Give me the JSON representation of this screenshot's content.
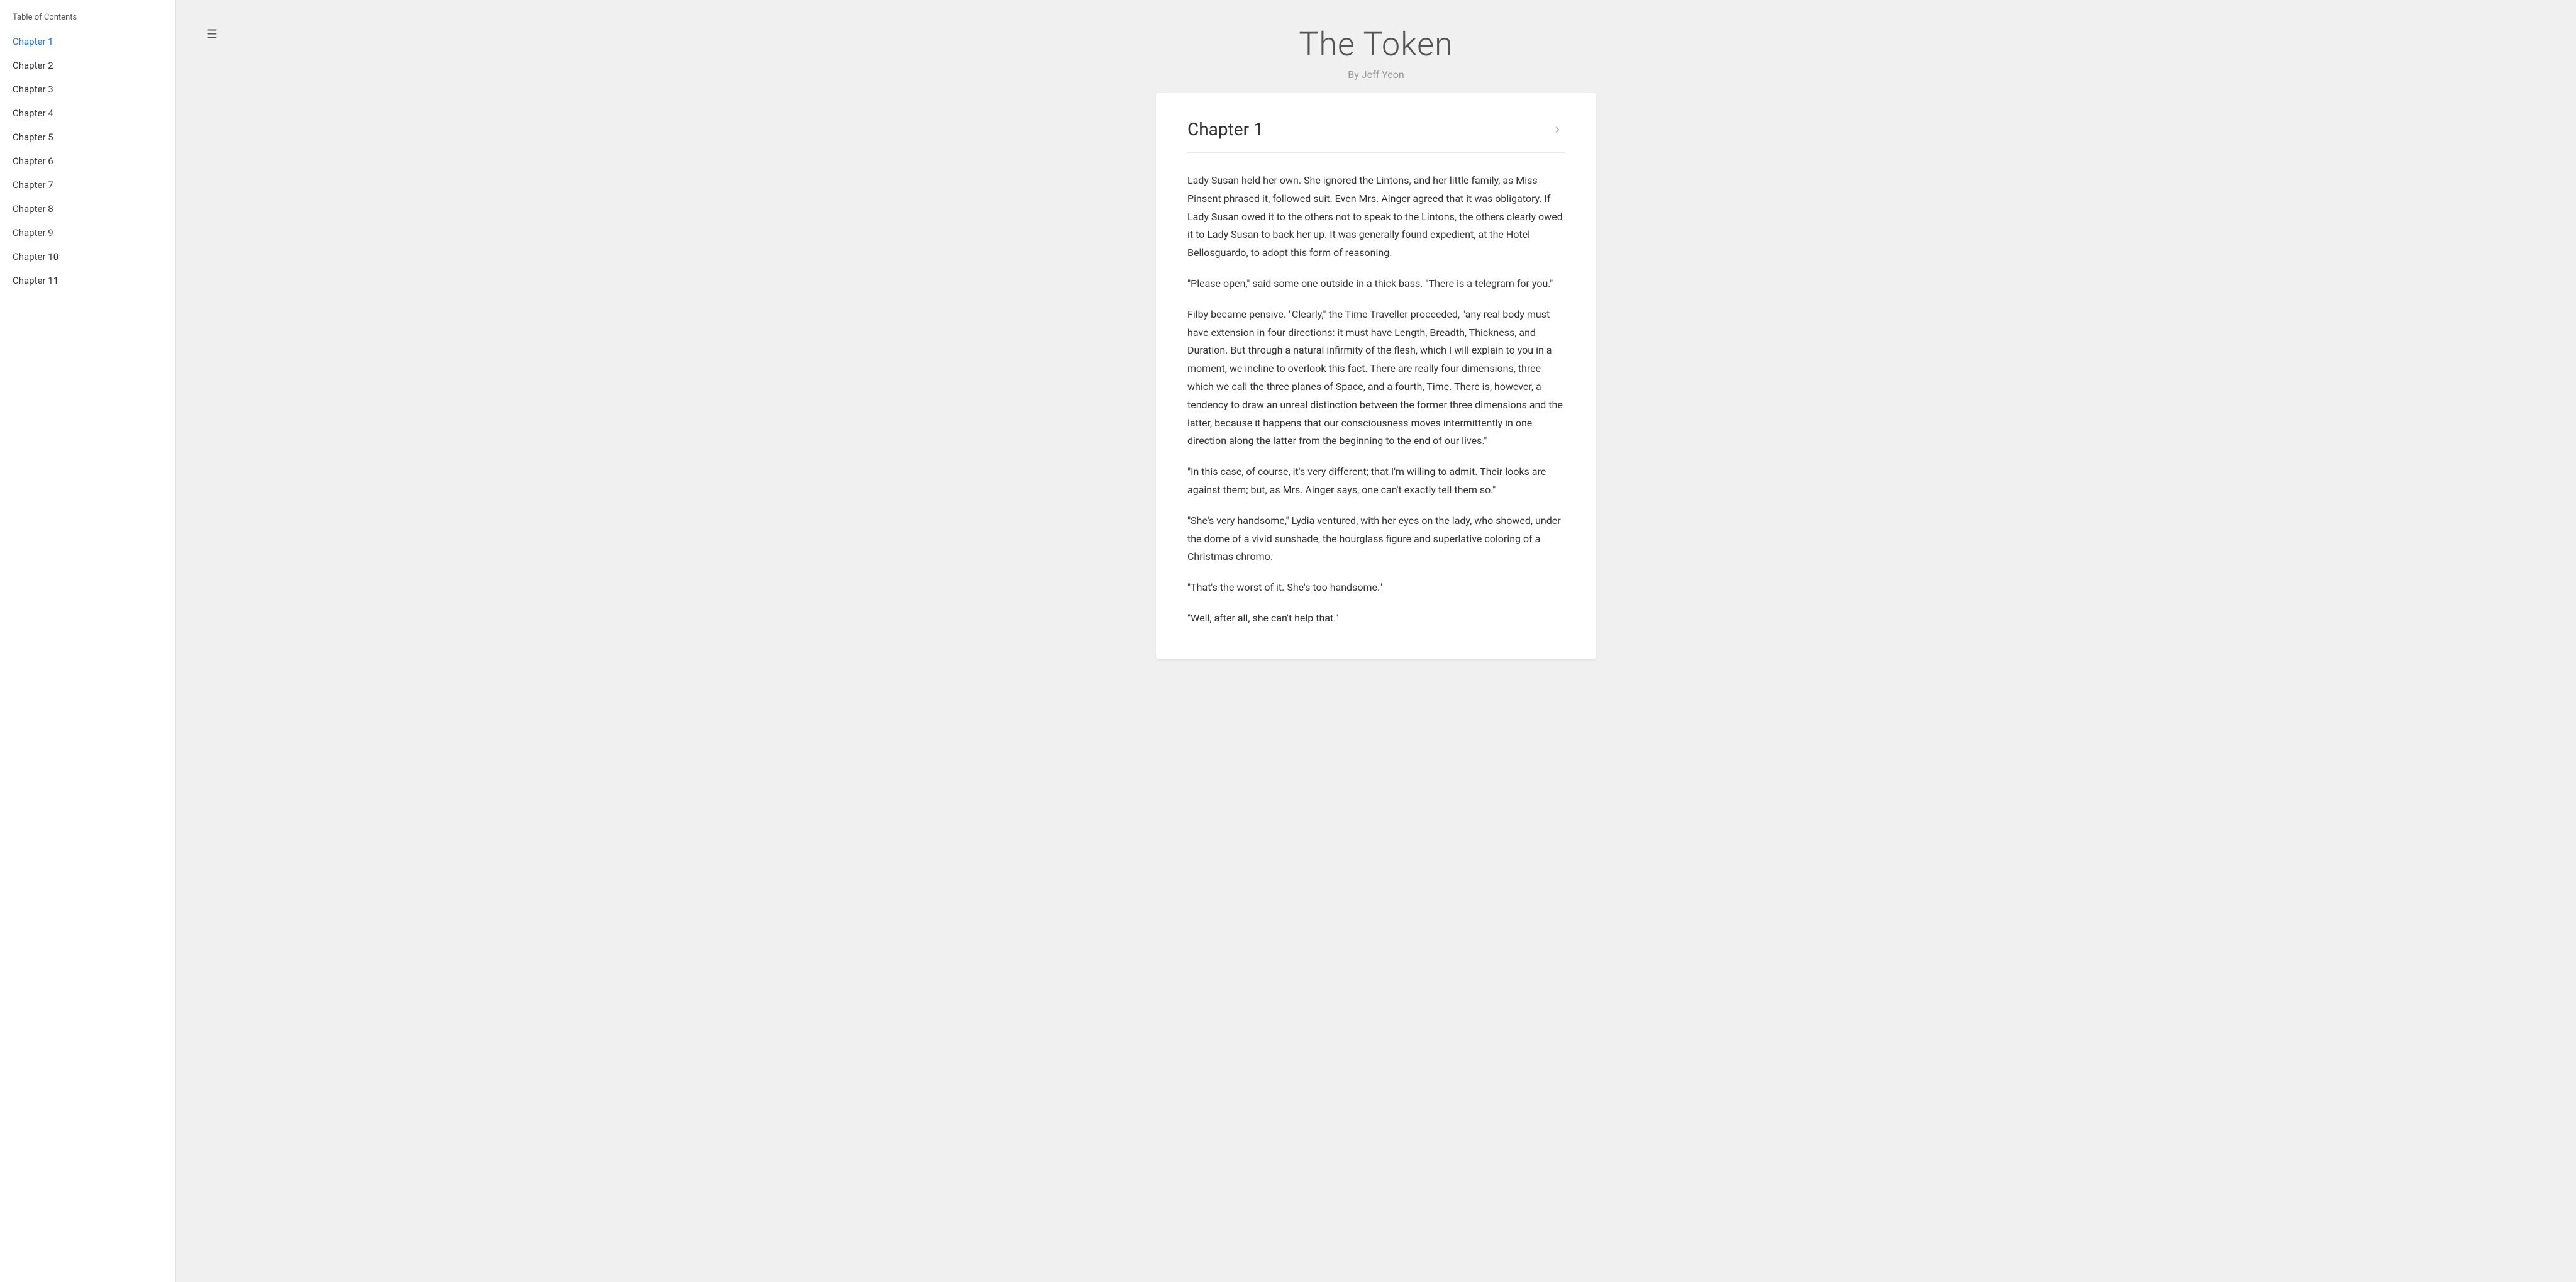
{
  "sidebar": {
    "toc_label": "Table of Contents",
    "chapters": [
      {
        "label": "Chapter 1",
        "active": true
      },
      {
        "label": "Chapter 2",
        "active": false
      },
      {
        "label": "Chapter 3",
        "active": false
      },
      {
        "label": "Chapter 4",
        "active": false
      },
      {
        "label": "Chapter 5",
        "active": false
      },
      {
        "label": "Chapter 6",
        "active": false
      },
      {
        "label": "Chapter 7",
        "active": false
      },
      {
        "label": "Chapter 8",
        "active": false
      },
      {
        "label": "Chapter 9",
        "active": false
      },
      {
        "label": "Chapter 10",
        "active": false
      },
      {
        "label": "Chapter 11",
        "active": false
      }
    ]
  },
  "header": {
    "book_title": "The Token",
    "book_author": "By Jeff Yeon",
    "menu_icon": "☰"
  },
  "chapter": {
    "title": "Chapter 1",
    "next_icon": "›",
    "paragraphs": [
      "Lady Susan held her own. She ignored the Lintons, and her little family, as Miss Pinsent phrased it, followed suit. Even Mrs. Ainger agreed that it was obligatory. If Lady Susan owed it to the others not to speak to the Lintons, the others clearly owed it to Lady Susan to back her up. It was generally found expedient, at the Hotel Bellosguardo, to adopt this form of reasoning.",
      "\"Please open,\" said some one outside in a thick bass. \"There is a telegram for you.\"",
      "Filby became pensive. \"Clearly,\" the Time Traveller proceeded, \"any real body must have extension in four directions: it must have Length, Breadth, Thickness, and Duration. But through a natural infirmity of the flesh, which I will explain to you in a moment, we incline to overlook this fact. There are really four dimensions, three which we call the three planes of Space, and a fourth, Time. There is, however, a tendency to draw an unreal distinction between the former three dimensions and the latter, because it happens that our consciousness moves intermittently in one direction along the latter from the beginning to the end of our lives.\"",
      "\"In this case, of course, it's very different; that I'm willing to admit. Their looks are against them; but, as Mrs. Ainger says, one can't exactly tell them so.\"",
      "\"She's very handsome,\" Lydia ventured, with her eyes on the lady, who showed, under the dome of a vivid sunshade, the hourglass figure and superlative coloring of a Christmas chromo.",
      "\"That's the worst of it. She's too handsome.\"",
      "\"Well, after all, she can't help that.\""
    ]
  }
}
